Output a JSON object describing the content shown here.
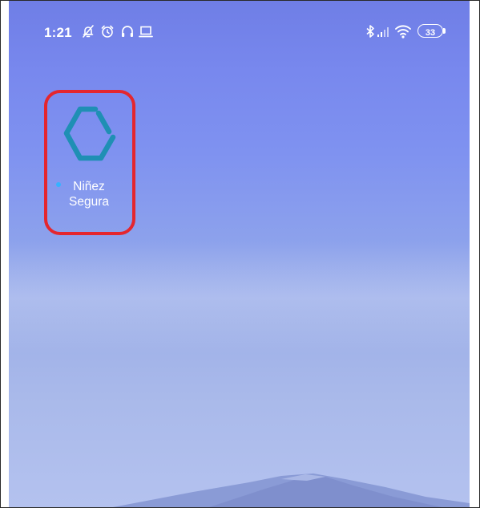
{
  "status_bar": {
    "time": "1:21",
    "left_icons": [
      "notifications-muted-icon",
      "alarm-clock-icon",
      "headphones-icon",
      "laptop-icon"
    ],
    "right_icons": [
      "bluetooth-icon",
      "signal-icon",
      "wifi-icon",
      "battery-icon"
    ],
    "battery_level": "33"
  },
  "home": {
    "apps": [
      {
        "label_line1": "Niñez",
        "label_line2": "Segura",
        "icon": "hexagon-logo-icon",
        "new_badge": true,
        "highlighted": true
      }
    ]
  },
  "colors": {
    "highlight": "#e4262e",
    "logo": "#1f8fb4",
    "badge": "#35b2ff"
  }
}
